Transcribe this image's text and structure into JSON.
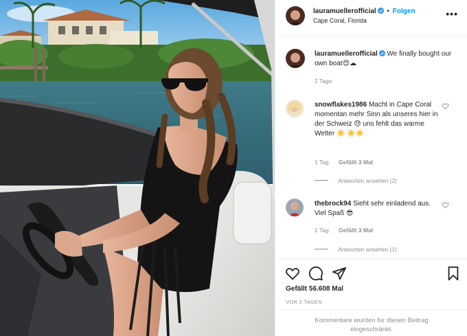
{
  "post": {
    "username": "lauramuellerofficial",
    "follow_label": "Folgen",
    "location": "Cape Coral, Florida",
    "more_icon": "•••"
  },
  "caption": {
    "username": "lauramuellerofficial",
    "text": "We finally bought our own boat😍☁",
    "time": "2 Tage"
  },
  "comments": [
    {
      "username": "snowflakes1986",
      "text": "Macht in Cape Coral momentan mehr Sinn als unseres hier in der Schweiz 😓 uns fehlt das warme Wetter ☀️ ☀️☀️",
      "time": "1 Tag",
      "likes": "Gefällt 3 Mal",
      "replies": "Antworten ansehen (2)"
    },
    {
      "username": "thebrock94",
      "text": "Sieht sehr einladend aus. Viel Spaß 😎",
      "time": "1 Tag",
      "likes": "Gefällt 3 Mal",
      "replies": "Antworten ansehen (1)"
    }
  ],
  "actions": {
    "likes_total": "Gefällt 56.608 Mal",
    "date": "VOR 2 TAGEN",
    "comments_closed": "Kommentare wurden für diesen Beitrag eingeschränkt."
  },
  "colors": {
    "accent": "#0095f6",
    "verified": "#3897f0",
    "muted": "#8e8e8e"
  }
}
